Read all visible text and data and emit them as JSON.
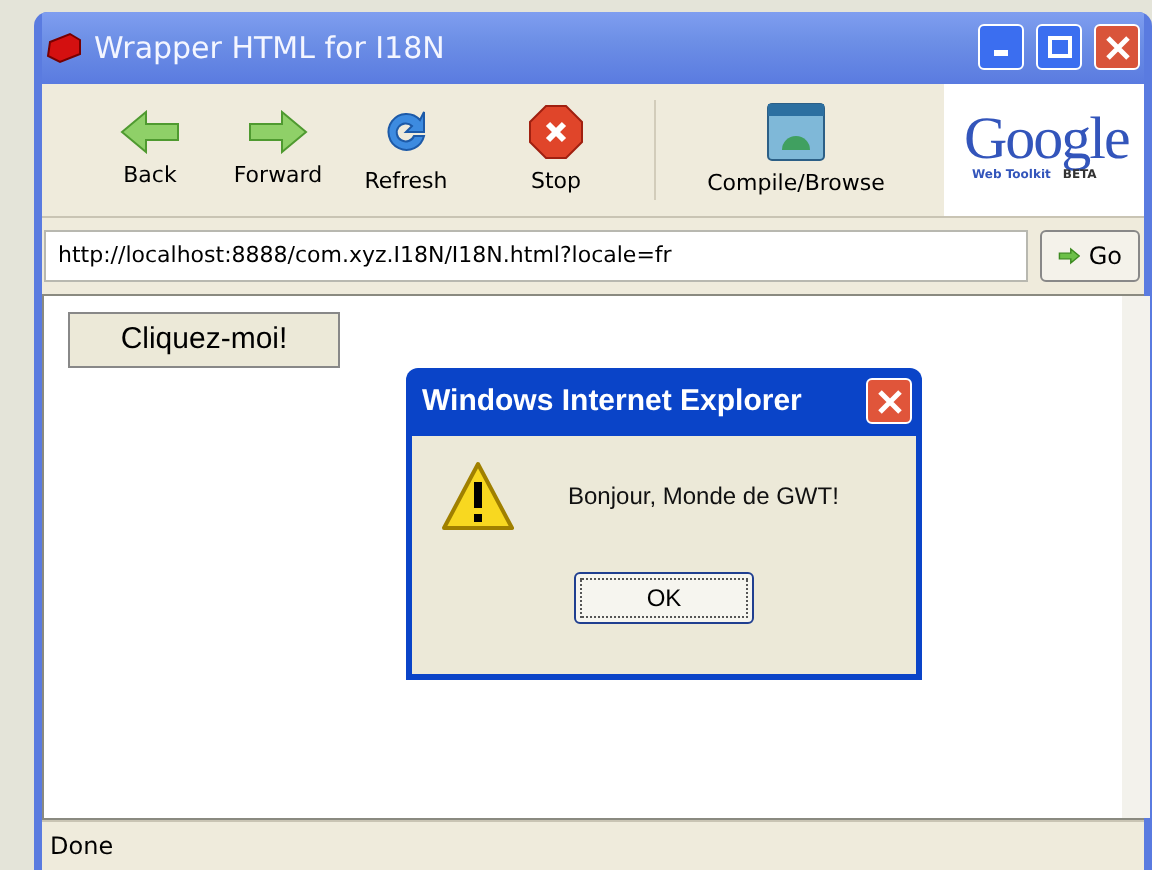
{
  "window": {
    "title": "Wrapper HTML for I18N"
  },
  "toolbar": [
    {
      "label": "Back",
      "kind": "back"
    },
    {
      "label": "Forward",
      "kind": "forward"
    },
    {
      "label": "Refresh",
      "kind": "refresh"
    },
    {
      "label": "Stop",
      "kind": "stop"
    },
    {
      "label": "Compile/Browse",
      "kind": "compile"
    }
  ],
  "logo": {
    "word": "Google",
    "subtitle": "Web Toolkit",
    "badge": "BETA"
  },
  "address": {
    "value": "http://localhost:8888/com.xyz.I18N/I18N.html?locale=fr",
    "go": "Go"
  },
  "page": {
    "button": "Cliquez-moi!"
  },
  "dialog": {
    "title": "Windows Internet Explorer",
    "message": "Bonjour, Monde de GWT!",
    "button": "OK"
  },
  "status_bar": "Done"
}
